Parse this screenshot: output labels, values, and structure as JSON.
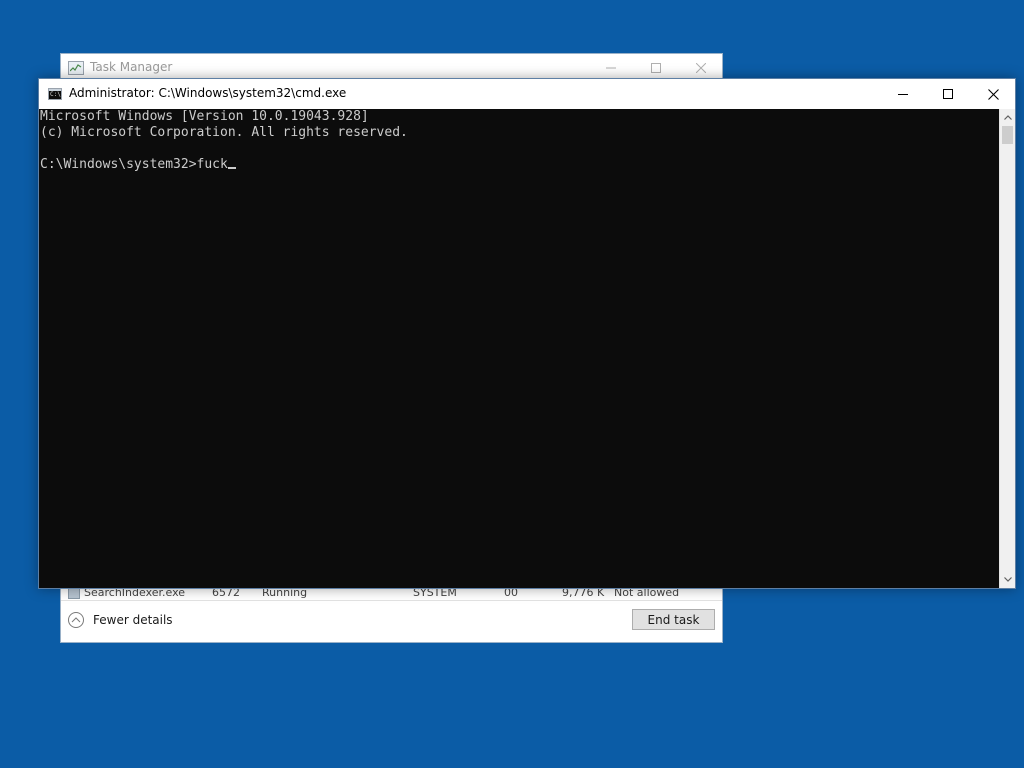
{
  "desktop": {
    "background": "#0b5ca6"
  },
  "task_manager": {
    "title": "Task Manager",
    "process_row": {
      "name": "SearchIndexer.exe",
      "pid": "6572",
      "status": "Running",
      "user": "SYSTEM",
      "cpu": "00",
      "memory": "9,776 K",
      "uac": "Not allowed"
    },
    "fewer_details_label": "Fewer details",
    "end_task_label": "End task",
    "icons": {
      "app": "task-manager-icon",
      "minimize": "minimize-icon",
      "maximize": "maximize-icon",
      "close": "close-icon",
      "collapse": "chevron-up-icon"
    }
  },
  "cmd": {
    "title": "Administrator: C:\\Windows\\system32\\cmd.exe",
    "icon_text": "C:\\",
    "lines": [
      "Microsoft Windows [Version 10.0.19043.928]",
      "(c) Microsoft Corporation. All rights reserved.",
      "",
      "C:\\Windows\\system32>fuck"
    ],
    "colors": {
      "background": "#0c0c0c",
      "foreground": "#cccccc"
    },
    "icons": {
      "app": "cmd-icon",
      "minimize": "minimize-icon",
      "maximize": "maximize-icon",
      "close": "close-icon",
      "scroll_up": "scroll-up-icon",
      "scroll_down": "scroll-down-icon"
    }
  }
}
